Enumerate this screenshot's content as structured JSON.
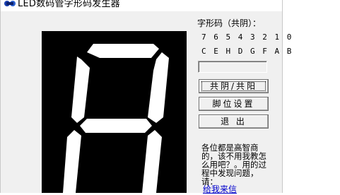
{
  "window": {
    "title": "LED数码管字形码发生器"
  },
  "panel": {
    "code_title": "字形码（共阴）：",
    "bit_numbers": "7 6 5 4 3 2 1 0",
    "segment_letters": "C E H D G F A B",
    "code_value": ""
  },
  "buttons": {
    "common_mode": "共阴/共阳",
    "pin_settings": "脚位设置",
    "exit": "退 出"
  },
  "note": {
    "text": "各位都是高智商的，该不用我教怎么用吧？。用的过程中发现问题，请：",
    "link": "给我来信"
  },
  "display": {
    "segments_lit": [
      "a",
      "b",
      "c",
      "e",
      "f",
      "g"
    ],
    "segment_color": "#ffffff",
    "background_color": "#000000"
  }
}
